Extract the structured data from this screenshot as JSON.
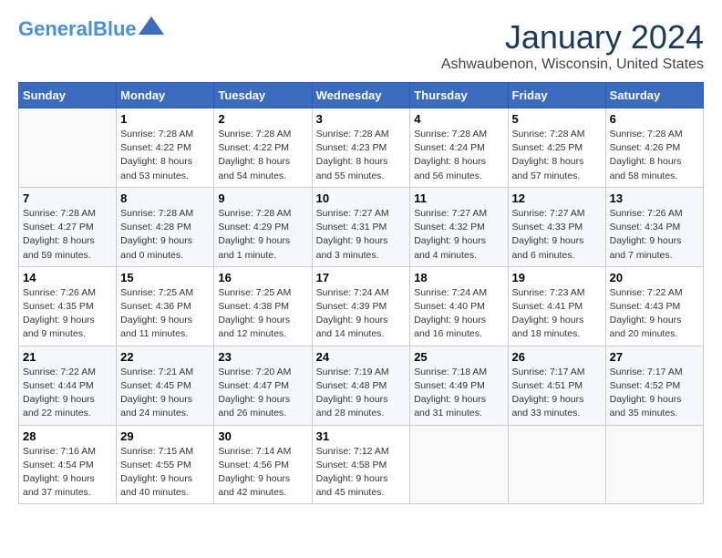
{
  "header": {
    "logo_line1": "General",
    "logo_line2": "Blue",
    "month": "January 2024",
    "location": "Ashwaubenon, Wisconsin, United States"
  },
  "weekdays": [
    "Sunday",
    "Monday",
    "Tuesday",
    "Wednesday",
    "Thursday",
    "Friday",
    "Saturday"
  ],
  "weeks": [
    [
      {
        "day": "",
        "sunrise": "",
        "sunset": "",
        "daylight": ""
      },
      {
        "day": "1",
        "sunrise": "Sunrise: 7:28 AM",
        "sunset": "Sunset: 4:22 PM",
        "daylight": "Daylight: 8 hours and 53 minutes."
      },
      {
        "day": "2",
        "sunrise": "Sunrise: 7:28 AM",
        "sunset": "Sunset: 4:22 PM",
        "daylight": "Daylight: 8 hours and 54 minutes."
      },
      {
        "day": "3",
        "sunrise": "Sunrise: 7:28 AM",
        "sunset": "Sunset: 4:23 PM",
        "daylight": "Daylight: 8 hours and 55 minutes."
      },
      {
        "day": "4",
        "sunrise": "Sunrise: 7:28 AM",
        "sunset": "Sunset: 4:24 PM",
        "daylight": "Daylight: 8 hours and 56 minutes."
      },
      {
        "day": "5",
        "sunrise": "Sunrise: 7:28 AM",
        "sunset": "Sunset: 4:25 PM",
        "daylight": "Daylight: 8 hours and 57 minutes."
      },
      {
        "day": "6",
        "sunrise": "Sunrise: 7:28 AM",
        "sunset": "Sunset: 4:26 PM",
        "daylight": "Daylight: 8 hours and 58 minutes."
      }
    ],
    [
      {
        "day": "7",
        "sunrise": "Sunrise: 7:28 AM",
        "sunset": "Sunset: 4:27 PM",
        "daylight": "Daylight: 8 hours and 59 minutes."
      },
      {
        "day": "8",
        "sunrise": "Sunrise: 7:28 AM",
        "sunset": "Sunset: 4:28 PM",
        "daylight": "Daylight: 9 hours and 0 minutes."
      },
      {
        "day": "9",
        "sunrise": "Sunrise: 7:28 AM",
        "sunset": "Sunset: 4:29 PM",
        "daylight": "Daylight: 9 hours and 1 minute."
      },
      {
        "day": "10",
        "sunrise": "Sunrise: 7:27 AM",
        "sunset": "Sunset: 4:31 PM",
        "daylight": "Daylight: 9 hours and 3 minutes."
      },
      {
        "day": "11",
        "sunrise": "Sunrise: 7:27 AM",
        "sunset": "Sunset: 4:32 PM",
        "daylight": "Daylight: 9 hours and 4 minutes."
      },
      {
        "day": "12",
        "sunrise": "Sunrise: 7:27 AM",
        "sunset": "Sunset: 4:33 PM",
        "daylight": "Daylight: 9 hours and 6 minutes."
      },
      {
        "day": "13",
        "sunrise": "Sunrise: 7:26 AM",
        "sunset": "Sunset: 4:34 PM",
        "daylight": "Daylight: 9 hours and 7 minutes."
      }
    ],
    [
      {
        "day": "14",
        "sunrise": "Sunrise: 7:26 AM",
        "sunset": "Sunset: 4:35 PM",
        "daylight": "Daylight: 9 hours and 9 minutes."
      },
      {
        "day": "15",
        "sunrise": "Sunrise: 7:25 AM",
        "sunset": "Sunset: 4:36 PM",
        "daylight": "Daylight: 9 hours and 11 minutes."
      },
      {
        "day": "16",
        "sunrise": "Sunrise: 7:25 AM",
        "sunset": "Sunset: 4:38 PM",
        "daylight": "Daylight: 9 hours and 12 minutes."
      },
      {
        "day": "17",
        "sunrise": "Sunrise: 7:24 AM",
        "sunset": "Sunset: 4:39 PM",
        "daylight": "Daylight: 9 hours and 14 minutes."
      },
      {
        "day": "18",
        "sunrise": "Sunrise: 7:24 AM",
        "sunset": "Sunset: 4:40 PM",
        "daylight": "Daylight: 9 hours and 16 minutes."
      },
      {
        "day": "19",
        "sunrise": "Sunrise: 7:23 AM",
        "sunset": "Sunset: 4:41 PM",
        "daylight": "Daylight: 9 hours and 18 minutes."
      },
      {
        "day": "20",
        "sunrise": "Sunrise: 7:22 AM",
        "sunset": "Sunset: 4:43 PM",
        "daylight": "Daylight: 9 hours and 20 minutes."
      }
    ],
    [
      {
        "day": "21",
        "sunrise": "Sunrise: 7:22 AM",
        "sunset": "Sunset: 4:44 PM",
        "daylight": "Daylight: 9 hours and 22 minutes."
      },
      {
        "day": "22",
        "sunrise": "Sunrise: 7:21 AM",
        "sunset": "Sunset: 4:45 PM",
        "daylight": "Daylight: 9 hours and 24 minutes."
      },
      {
        "day": "23",
        "sunrise": "Sunrise: 7:20 AM",
        "sunset": "Sunset: 4:47 PM",
        "daylight": "Daylight: 9 hours and 26 minutes."
      },
      {
        "day": "24",
        "sunrise": "Sunrise: 7:19 AM",
        "sunset": "Sunset: 4:48 PM",
        "daylight": "Daylight: 9 hours and 28 minutes."
      },
      {
        "day": "25",
        "sunrise": "Sunrise: 7:18 AM",
        "sunset": "Sunset: 4:49 PM",
        "daylight": "Daylight: 9 hours and 31 minutes."
      },
      {
        "day": "26",
        "sunrise": "Sunrise: 7:17 AM",
        "sunset": "Sunset: 4:51 PM",
        "daylight": "Daylight: 9 hours and 33 minutes."
      },
      {
        "day": "27",
        "sunrise": "Sunrise: 7:17 AM",
        "sunset": "Sunset: 4:52 PM",
        "daylight": "Daylight: 9 hours and 35 minutes."
      }
    ],
    [
      {
        "day": "28",
        "sunrise": "Sunrise: 7:16 AM",
        "sunset": "Sunset: 4:54 PM",
        "daylight": "Daylight: 9 hours and 37 minutes."
      },
      {
        "day": "29",
        "sunrise": "Sunrise: 7:15 AM",
        "sunset": "Sunset: 4:55 PM",
        "daylight": "Daylight: 9 hours and 40 minutes."
      },
      {
        "day": "30",
        "sunrise": "Sunrise: 7:14 AM",
        "sunset": "Sunset: 4:56 PM",
        "daylight": "Daylight: 9 hours and 42 minutes."
      },
      {
        "day": "31",
        "sunrise": "Sunrise: 7:12 AM",
        "sunset": "Sunset: 4:58 PM",
        "daylight": "Daylight: 9 hours and 45 minutes."
      },
      {
        "day": "",
        "sunrise": "",
        "sunset": "",
        "daylight": ""
      },
      {
        "day": "",
        "sunrise": "",
        "sunset": "",
        "daylight": ""
      },
      {
        "day": "",
        "sunrise": "",
        "sunset": "",
        "daylight": ""
      }
    ]
  ]
}
